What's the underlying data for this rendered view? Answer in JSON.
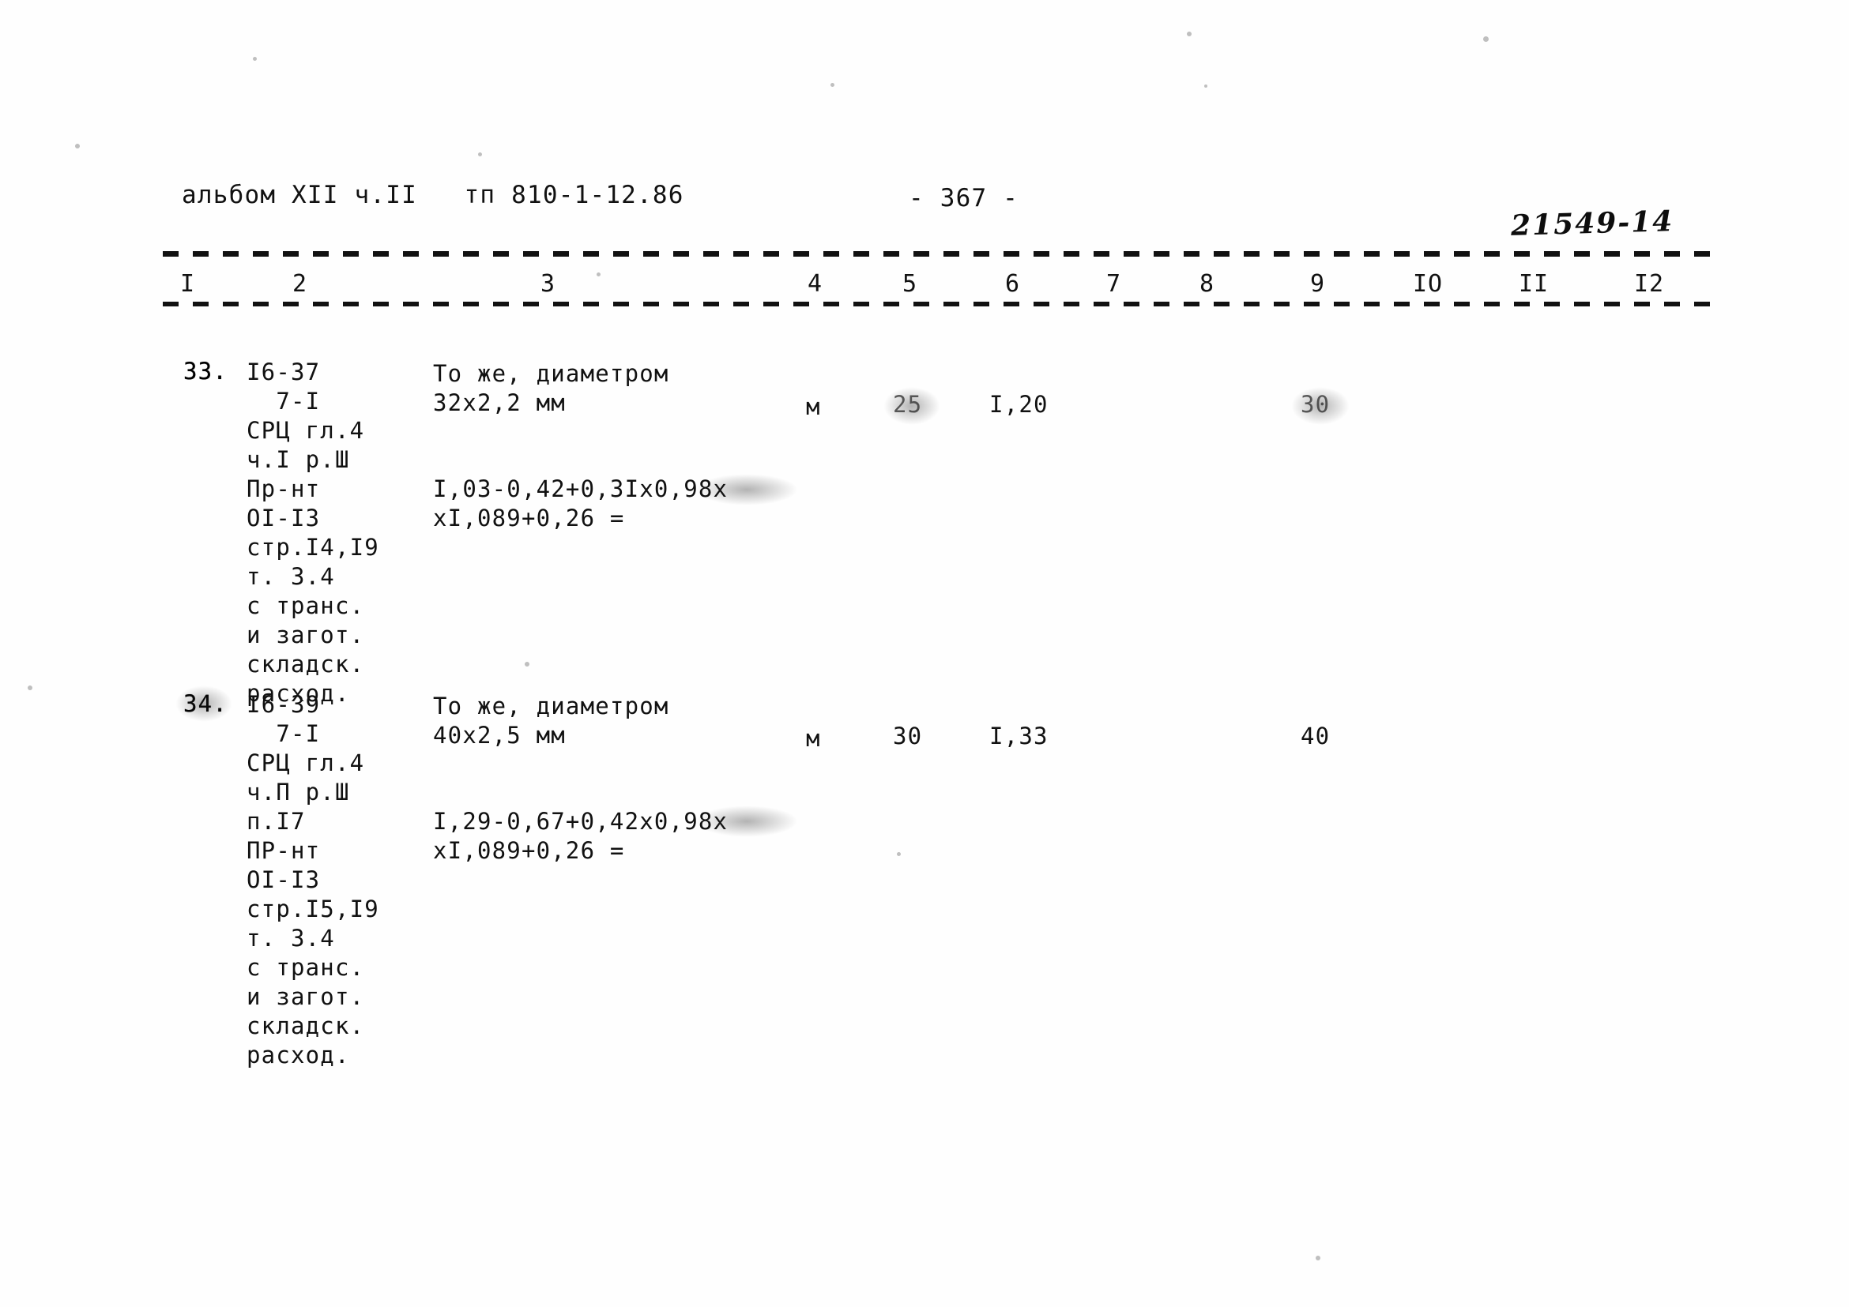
{
  "document": {
    "header_left": "альбом XII ч.II   тп 810-1-12.86",
    "page_number": "- 367 -",
    "handwritten_code": "21549-14"
  },
  "table": {
    "column_headers": [
      "I",
      "2",
      "3",
      "4",
      "5",
      "6",
      "7",
      "8",
      "9",
      "IO",
      "II",
      "I2"
    ],
    "rows": [
      {
        "num": "33.",
        "col2": "I6-37\n  7-I\nСРЦ гл.4\nч.I р.Ш\nПр-нт\nОI-I3\nстр.I4,I9\nт. 3.4\nс транс.\nи загот.\nскладск.\nрасход.",
        "col3_title": "То же, диаметром\n32х2,2 мм",
        "col3_formula": "I,03-0,42+0,3Iх0,98х\nхI,089+0,26 =",
        "col4": "м",
        "col5": "25",
        "col6": "I,20",
        "col7": "",
        "col8": "",
        "col9": "30",
        "col10": "",
        "col11": "",
        "col12": ""
      },
      {
        "num": "34.",
        "col2": "I6-39\n  7-I\nСРЦ гл.4\nч.П р.Ш\nп.I7\nПР-нт\nОI-I3\nстр.I5,I9\nт. 3.4\nс транс.\nи загот.\nскладск.\nрасход.",
        "col3_title": "То же, диаметром\n40х2,5 мм",
        "col3_formula": "I,29-0,67+0,42х0,98х\nхI,089+0,26 =",
        "col4": "м",
        "col5": "30",
        "col6": "I,33",
        "col7": "",
        "col8": "",
        "col9": "40",
        "col10": "",
        "col11": "",
        "col12": ""
      }
    ]
  }
}
